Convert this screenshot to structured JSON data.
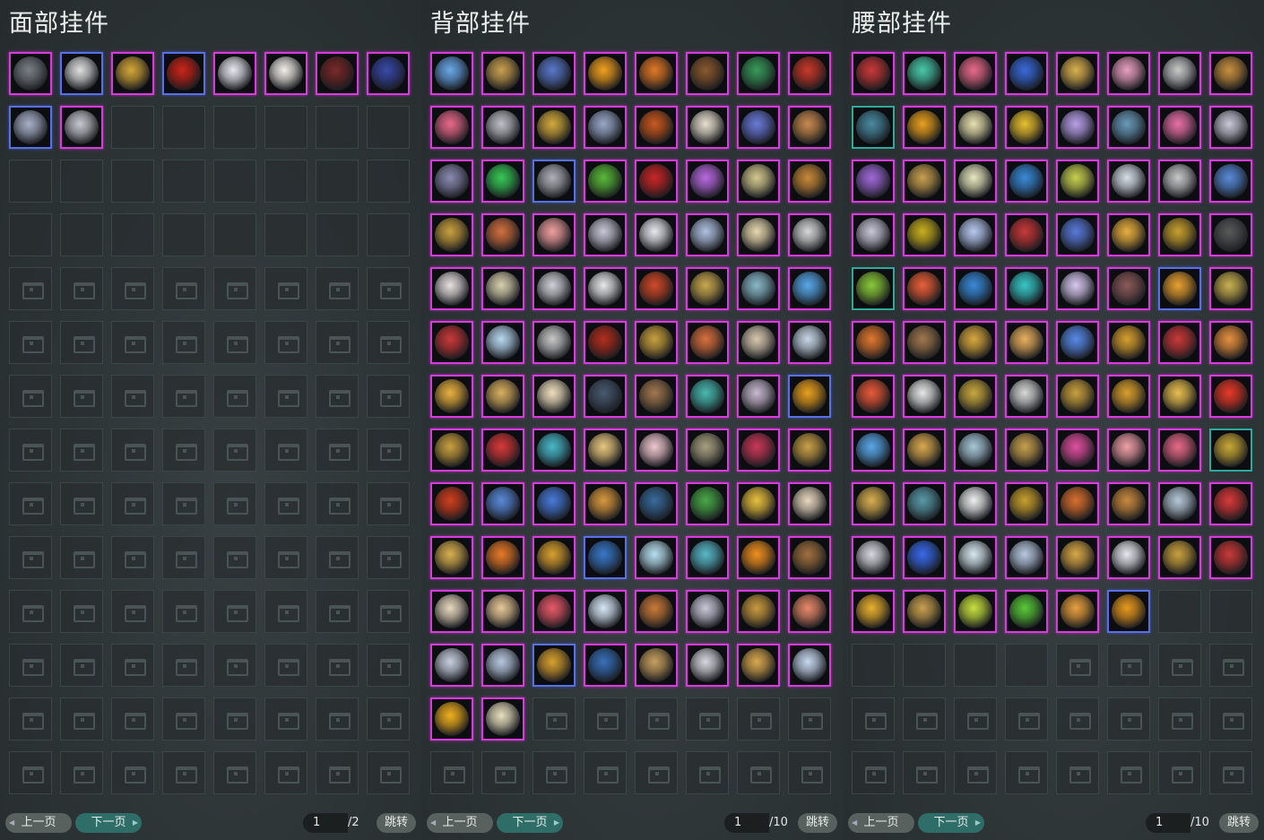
{
  "panels": [
    {
      "title": "面部挂件",
      "filled": 10,
      "locked_from": 32,
      "prev_label": "上一页",
      "next_label": "下一页",
      "page_value": "1",
      "page_total": "/2",
      "jump_label": "跳转",
      "item_colors": [
        "#7a7f86",
        "#e0e0e0",
        "#d4a63a",
        "#c8261a",
        "#e8e8f0",
        "#f2efe8",
        "#7a2a2a",
        "#3a4aa8",
        "#a8b0c8",
        "#c8c8d0"
      ],
      "item_rarity": [
        "purple",
        "blue",
        "purple",
        "blue",
        "purple",
        "purple",
        "purple",
        "purple",
        "blue",
        "purple"
      ]
    },
    {
      "title": "背部挂件",
      "filled": 98,
      "locked_from": 98,
      "prev_label": "上一页",
      "next_label": "下一页",
      "page_value": "1",
      "page_total": "/10",
      "jump_label": "跳转",
      "item_colors": [
        "#6aa8e8",
        "#c8a050",
        "#5a78c8",
        "#f0a020",
        "#e07828",
        "#8a5a30",
        "#3a9a5a",
        "#c83a2a",
        "#e86a8a",
        "#c0c0c8",
        "#d4aa40",
        "#9aa8c8",
        "#c85a20",
        "#e8e0d0",
        "#6a7ad8",
        "#c88a50",
        "#8a8ab0",
        "#38c858",
        "#b0b0b8",
        "#5ab83a",
        "#c82828",
        "#b86ae0",
        "#d4c890",
        "#c88a3a",
        "#c8a040",
        "#d07040",
        "#f0a0a0",
        "#c8c8d8",
        "#e8e8f0",
        "#b0c0e0",
        "#e8d8b0",
        "#d8d8d8",
        "#e8e0e0",
        "#d8d0b0",
        "#d0d0d8",
        "#e8e8e8",
        "#d04a2a",
        "#c8a850",
        "#8ab8c8",
        "#58a8e8",
        "#c83a3a",
        "#b8d8f0",
        "#c8c8c8",
        "#b03020",
        "#c8a040",
        "#d87040",
        "#d8c8b0",
        "#c8d8e8",
        "#e8b040",
        "#d8b060",
        "#f0e0c0",
        "#4a5a70",
        "#a07850",
        "#4ab8b0",
        "#c8b8d0",
        "#e8a020",
        "#c8a040",
        "#d83a3a",
        "#4ab8c8",
        "#e8c880",
        "#f0c8d0",
        "#a8a080",
        "#c83a5a",
        "#c8a048",
        "#d04020",
        "#5a8ad8",
        "#4a7ad8",
        "#d89840",
        "#3a6a9a",
        "#4aa84a",
        "#e8c040",
        "#e8d8c0",
        "#d8b050",
        "#e87a2a",
        "#d8a030",
        "#3a78c8",
        "#b8e0f0",
        "#5ab8c8",
        "#f09020",
        "#a07040",
        "#e8d8c0",
        "#e8c898",
        "#e85a6a",
        "#d8e8f8",
        "#c87a3a",
        "#c8c8d8",
        "#c89a40",
        "#e88a6a",
        "#c8d0e0",
        "#b8c8e0",
        "#d8a030",
        "#3a70b8",
        "#c8a060",
        "#d8d8e0",
        "#d8a850",
        "#c8d8f0",
        "#f0b020",
        "#e8e0c0"
      ],
      "item_rarity": [
        "purple",
        "purple",
        "purple",
        "purple",
        "purple",
        "purple",
        "purple",
        "purple",
        "purple",
        "purple",
        "purple",
        "purple",
        "purple",
        "purple",
        "purple",
        "purple",
        "purple",
        "purple",
        "blue",
        "purple",
        "purple",
        "purple",
        "purple",
        "purple",
        "purple",
        "purple",
        "purple",
        "purple",
        "purple",
        "purple",
        "purple",
        "purple",
        "purple",
        "purple",
        "purple",
        "purple",
        "purple",
        "purple",
        "purple",
        "purple",
        "purple",
        "purple",
        "purple",
        "purple",
        "purple",
        "purple",
        "purple",
        "purple",
        "purple",
        "purple",
        "purple",
        "purple",
        "purple",
        "purple",
        "purple",
        "blue",
        "purple",
        "purple",
        "purple",
        "purple",
        "purple",
        "purple",
        "purple",
        "purple",
        "purple",
        "purple",
        "purple",
        "purple",
        "purple",
        "purple",
        "purple",
        "purple",
        "purple",
        "purple",
        "purple",
        "blue",
        "purple",
        "purple",
        "purple",
        "purple",
        "purple",
        "purple",
        "purple",
        "purple",
        "purple",
        "purple",
        "purple",
        "purple",
        "purple",
        "purple",
        "blue",
        "purple",
        "purple",
        "purple",
        "purple",
        "purple",
        "purple",
        "purple"
      ]
    },
    {
      "title": "腰部挂件",
      "filled": 86,
      "locked_from": 92,
      "prev_label": "上一页",
      "next_label": "下一页",
      "page_value": "1",
      "page_total": "/10",
      "jump_label": "跳转",
      "item_colors": [
        "#c83a3a",
        "#4ac8a8",
        "#e86a8a",
        "#3a6ad8",
        "#d8b050",
        "#e8a0c0",
        "#c8c8c8",
        "#c89040",
        "#4a8aa0",
        "#e8a020",
        "#e8e0b0",
        "#e8c030",
        "#b8a0e8",
        "#6a9ab8",
        "#e870a8",
        "#c8c8d8",
        "#a06ad8",
        "#c8a050",
        "#e8e8c0",
        "#3a8ad8",
        "#c8d050",
        "#d8e0e8",
        "#c8c8c8",
        "#5a8ad8",
        "#c8c8d8",
        "#c8b020",
        "#b8c8f0",
        "#c83a3a",
        "#5a7ad8",
        "#e8b040",
        "#c8a030",
        "#5a5a5a",
        "#8ac83a",
        "#e8603a",
        "#3a8ad8",
        "#3ac8c8",
        "#d8c8f0",
        "#8a5a5a",
        "#e8a030",
        "#c8b050",
        "#e07830",
        "#a07850",
        "#d8a840",
        "#e8b060",
        "#5a8ae8",
        "#d8a030",
        "#c83a3a",
        "#e89040",
        "#e85a3a",
        "#e8e8e8",
        "#c8a840",
        "#d8d8d8",
        "#c8a040",
        "#d8a030",
        "#e8c050",
        "#e83a2a",
        "#5aa8e8",
        "#d8a850",
        "#a8c8d8",
        "#c8a050",
        "#e050a0",
        "#f0a0a8",
        "#e86a8a",
        "#c8a838",
        "#d8b050",
        "#5a9aa8",
        "#f0f0f0",
        "#c8a030",
        "#d87030",
        "#c88a40",
        "#b8c8d8",
        "#d83a3a",
        "#d8d8e0",
        "#3a6ae8",
        "#d8e8f0",
        "#b8c8e0",
        "#d8a848",
        "#e8e8f0",
        "#c8a040",
        "#c83a3a",
        "#e8b030",
        "#c8a050",
        "#c8e040",
        "#5ac83a",
        "#e8a040",
        "#e89a20"
      ],
      "item_rarity": [
        "purple",
        "purple",
        "purple",
        "purple",
        "purple",
        "purple",
        "purple",
        "purple",
        "teal",
        "purple",
        "purple",
        "purple",
        "purple",
        "purple",
        "purple",
        "purple",
        "purple",
        "purple",
        "purple",
        "purple",
        "purple",
        "purple",
        "purple",
        "purple",
        "purple",
        "purple",
        "purple",
        "purple",
        "purple",
        "purple",
        "purple",
        "purple",
        "teal",
        "purple",
        "purple",
        "purple",
        "purple",
        "purple",
        "blue",
        "purple",
        "purple",
        "purple",
        "purple",
        "purple",
        "purple",
        "purple",
        "purple",
        "purple",
        "purple",
        "purple",
        "purple",
        "purple",
        "purple",
        "purple",
        "purple",
        "purple",
        "purple",
        "purple",
        "purple",
        "purple",
        "purple",
        "purple",
        "purple",
        "teal",
        "purple",
        "purple",
        "purple",
        "purple",
        "purple",
        "purple",
        "purple",
        "purple",
        "purple",
        "purple",
        "purple",
        "purple",
        "purple",
        "purple",
        "purple",
        "purple",
        "purple",
        "purple",
        "purple",
        "purple",
        "purple",
        "blue"
      ]
    }
  ]
}
